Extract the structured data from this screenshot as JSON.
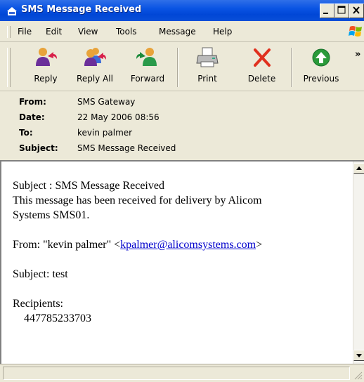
{
  "window": {
    "title": "SMS Message Received"
  },
  "menu": {
    "items": [
      "File",
      "Edit",
      "View",
      "Tools",
      "Message",
      "Help"
    ]
  },
  "toolbar": {
    "reply": "Reply",
    "reply_all": "Reply All",
    "forward": "Forward",
    "print": "Print",
    "delete": "Delete",
    "previous": "Previous",
    "more_glyph": "»"
  },
  "header": {
    "from_label": "From:",
    "from_value": "SMS Gateway",
    "date_label": "Date:",
    "date_value": "22 May 2006 08:56",
    "to_label": "To:",
    "to_value": "kevin palmer",
    "subject_label": "Subject:",
    "subject_value": "SMS Message Received"
  },
  "message": {
    "line1": "Subject : SMS Message Received",
    "line2": "This message has been received for delivery by Alicom",
    "line3": "Systems SMS01.",
    "from_prefix": "From: \"kevin palmer\" <",
    "from_email": "kpalmer@alicomsystems.com",
    "from_suffix": ">",
    "subject_line": "Subject: test",
    "recipients_label": "Recipients:",
    "recipient_number": "447785233703"
  },
  "colors": {
    "title_bar": "#0a54e3",
    "window_bg": "#ece9d8",
    "link": "#0000cc"
  }
}
